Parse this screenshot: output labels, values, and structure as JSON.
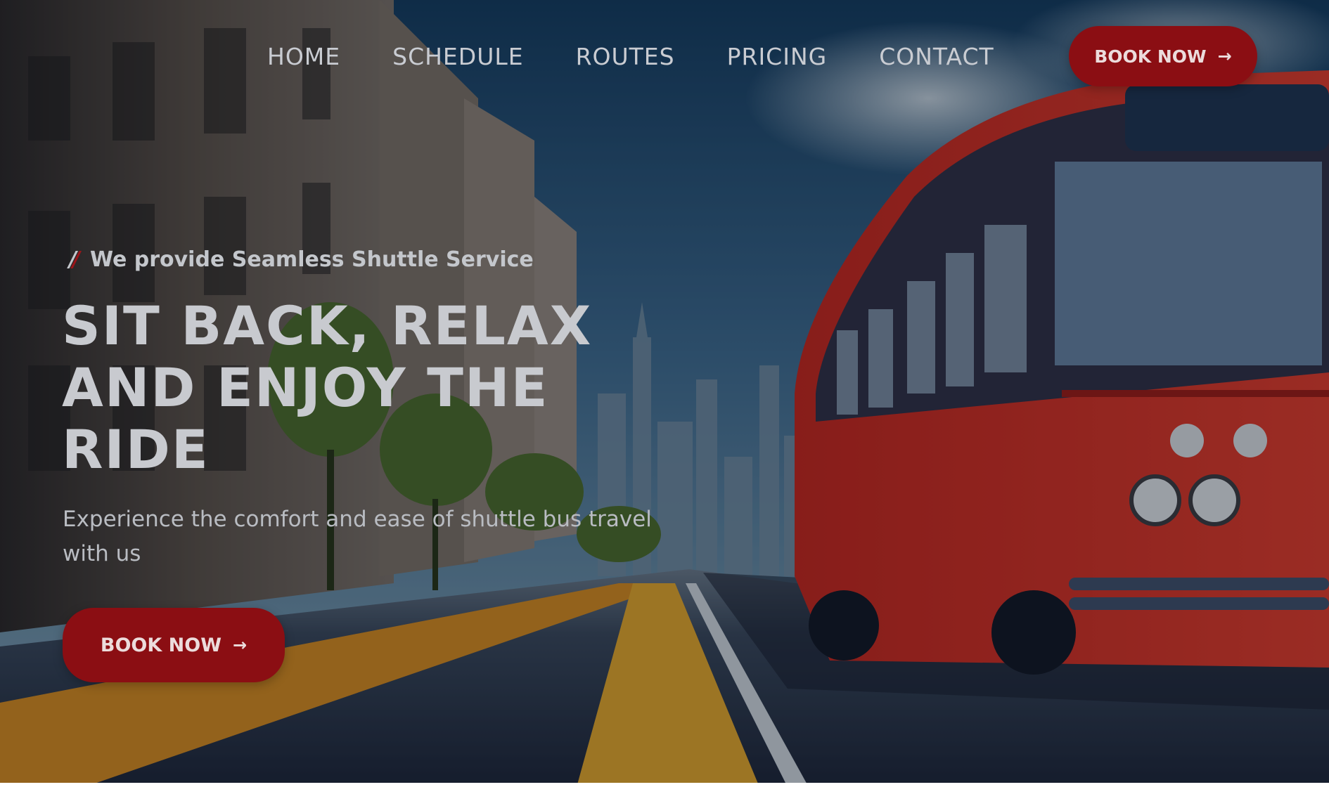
{
  "nav": {
    "items": [
      {
        "label": "HOME"
      },
      {
        "label": "SCHEDULE"
      },
      {
        "label": "ROUTES"
      },
      {
        "label": "PRICING"
      },
      {
        "label": "CONTACT"
      }
    ],
    "book_button": {
      "label": "BOOK NOW",
      "icon": "arrow-right-icon"
    }
  },
  "hero": {
    "tagline": "We provide Seamless Shuttle Service",
    "tagline_icon": "double-slash-icon",
    "headline": [
      "SIT BACK, RELAX",
      "AND ENJOY THE",
      "RIDE"
    ],
    "subtext": "Experience the comfort and ease of shuttle bus travel with us",
    "cta": {
      "label": "BOOK NOW",
      "icon": "arrow-right-icon"
    },
    "background": "city street with red shuttle bus"
  },
  "colors": {
    "accent": "#8b0e13",
    "text": "#c8cacf"
  }
}
